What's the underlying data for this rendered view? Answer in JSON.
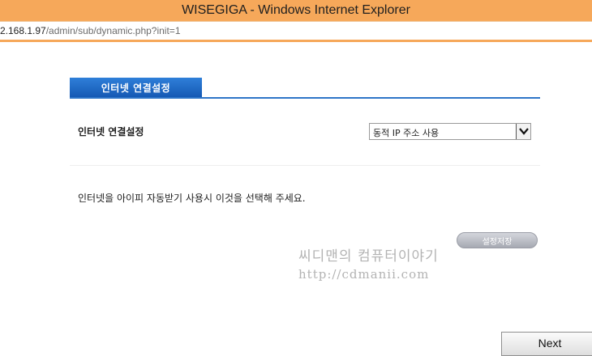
{
  "window": {
    "title": "WISEGIGA - Windows Internet Explorer"
  },
  "address_bar": {
    "url_host": "2.168.1.97",
    "url_rest": "/admin/sub/dynamic.php?init=1"
  },
  "section": {
    "tab_label": "인터넷 연결설정"
  },
  "form": {
    "label": "인터넷 연결설정",
    "select_value": "동적 IP 주소 사용",
    "description": "인터넷을 아이피 자동받기 사용시 이것을 선택해 주세요.",
    "save_label": "설정저장"
  },
  "watermark": {
    "title": "씨디맨의 컴퓨터이야기",
    "url": "http://cdmanii.com"
  },
  "footer": {
    "next_label": "Next"
  },
  "colors": {
    "title_bar": "#f6a85a",
    "tab_accent": "#2e75c8"
  }
}
